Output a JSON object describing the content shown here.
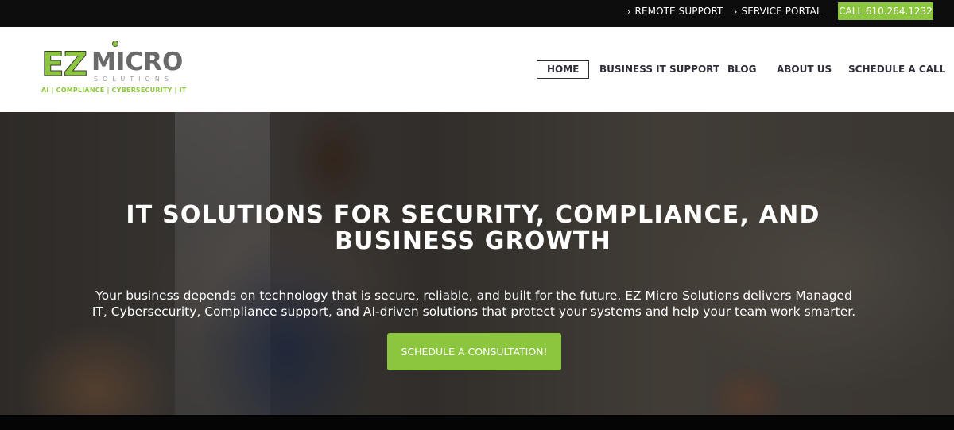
{
  "topbar": {
    "remote_support": "REMOTE SUPPORT",
    "service_portal": "SERVICE PORTAL",
    "call_label": "CALL 610.264.1232",
    "link_icon": "chevron-right-icon"
  },
  "logo": {
    "ez": "EZ",
    "micro": "MICRO",
    "solutions": "SOLUTIONS",
    "tagline": "AI | COMPLIANCE | CYBERSECURITY | IT"
  },
  "nav": {
    "items": [
      {
        "label": "HOME",
        "active": true
      },
      {
        "label": "BUSINESS IT SUPPORT",
        "active": false
      },
      {
        "label": "BLOG",
        "active": false
      },
      {
        "label": "ABOUT US",
        "active": false
      },
      {
        "label": "SCHEDULE A CALL",
        "active": false
      }
    ]
  },
  "hero": {
    "title": "IT SOLUTIONS FOR SECURITY, COMPLIANCE, AND BUSINESS GROWTH",
    "text": "Your business depends on technology that is secure, reliable, and built for the future. EZ Micro Solutions delivers Managed IT, Cybersecurity, Compliance support, and AI-driven solutions that protect your systems and help your team work smarter.",
    "cta": "SCHEDULE A CONSULTATION!"
  },
  "colors": {
    "accent": "#8cc63f",
    "topbar_bg": "#0d0d0d",
    "nav_text": "#2e2e3a"
  }
}
